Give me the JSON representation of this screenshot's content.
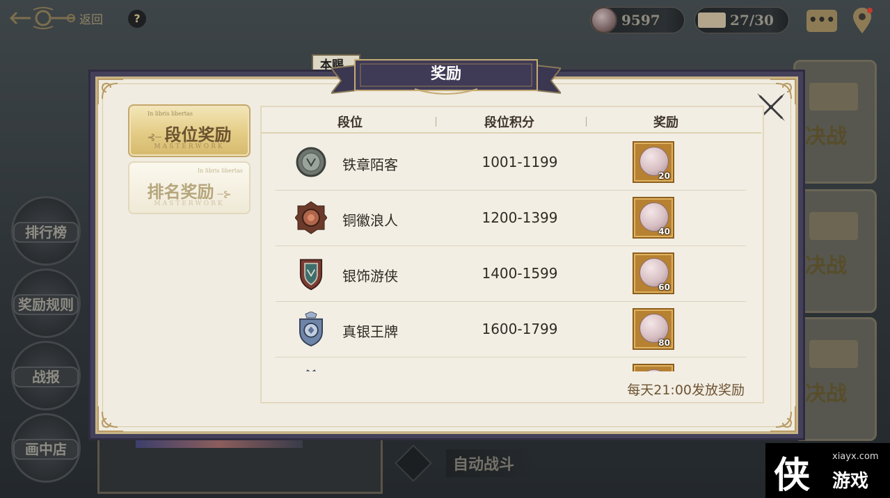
{
  "topbar": {
    "back_label": "返回",
    "help_label": "?",
    "coins": "9597",
    "tickets": "27/30",
    "chat_label": "•••"
  },
  "side_menu": [
    {
      "label": "排行榜"
    },
    {
      "label": "奖励规则"
    },
    {
      "label": "战报"
    },
    {
      "label": "画中店"
    }
  ],
  "right_cards": [
    {
      "label": "决战"
    },
    {
      "label": "决战"
    },
    {
      "label": "决战"
    }
  ],
  "auto_battle_label": "自动战斗",
  "peek_tab_label": "本赐",
  "modal": {
    "title": "奖励",
    "tabs": [
      {
        "label": "段位奖励",
        "latin": "In libris libertas",
        "sub": "MASTERWORK",
        "active": true
      },
      {
        "label": "排名奖励",
        "latin": "In libris libertas",
        "sub": "MASTERWORK",
        "active": false
      }
    ],
    "columns": [
      "段位",
      "段位积分",
      "奖励"
    ],
    "rows": [
      {
        "tier": "铁章陌客",
        "range": "1001-1199",
        "reward_qty": "20",
        "badge": "iron-badge-icon"
      },
      {
        "tier": "铜徽浪人",
        "range": "1200-1399",
        "reward_qty": "40",
        "badge": "bronze-badge-icon"
      },
      {
        "tier": "银饰游侠",
        "range": "1400-1599",
        "reward_qty": "60",
        "badge": "silver-badge-icon"
      },
      {
        "tier": "真银王牌",
        "range": "1600-1799",
        "reward_qty": "80",
        "badge": "true-silver-badge-icon"
      },
      {
        "tier": "",
        "range": "",
        "reward_qty": "",
        "badge": "crown-badge-icon"
      }
    ],
    "daily_note": "每天21:00发放奖励"
  },
  "watermark": {
    "logo": "侠",
    "url": "xiayx.com",
    "name": "游戏"
  },
  "colors": {
    "modal_bg": "#f0ece1",
    "banner": "#44405a",
    "gold_tab": "#e4cc86",
    "reward_frame": "#b78132"
  }
}
